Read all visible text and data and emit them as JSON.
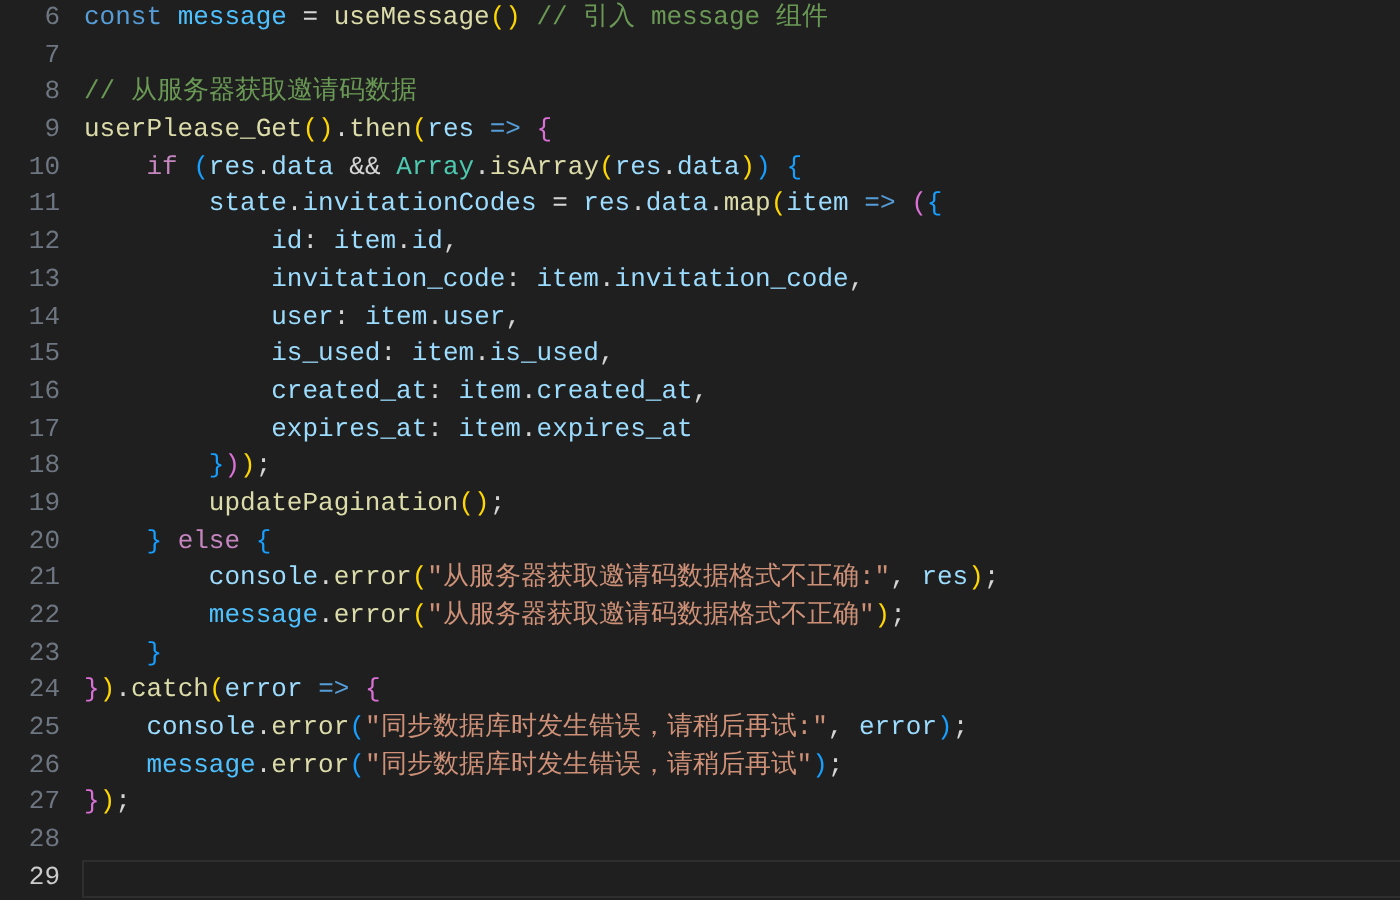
{
  "editor": {
    "lines": [
      {
        "number": "6",
        "current": false,
        "tokens": [
          {
            "kind": "storage",
            "text": "const "
          },
          {
            "kind": "const",
            "text": "message"
          },
          {
            "kind": "plain",
            "text": " = "
          },
          {
            "kind": "fn",
            "text": "useMessage"
          },
          {
            "kind": "b1",
            "text": "()"
          },
          {
            "kind": "comment",
            "text": " // 引入 message 组件"
          }
        ]
      },
      {
        "number": "7",
        "current": false
      },
      {
        "number": "8",
        "current": false,
        "tokens": [
          {
            "kind": "comment",
            "text": "// 从服务器获取邀请码数据"
          }
        ]
      },
      {
        "number": "9",
        "current": false,
        "tokens": [
          {
            "kind": "fn",
            "text": "userPlease_Get"
          },
          {
            "kind": "b1",
            "text": "()"
          },
          {
            "kind": "plain",
            "text": "."
          },
          {
            "kind": "fn",
            "text": "then"
          },
          {
            "kind": "b1",
            "text": "("
          },
          {
            "kind": "var",
            "text": "res"
          },
          {
            "kind": "storage",
            "text": " => "
          },
          {
            "kind": "b2",
            "text": "{"
          }
        ]
      },
      {
        "number": "10",
        "current": false,
        "tokens": [
          {
            "kind": "kw",
            "text": "    if "
          },
          {
            "kind": "b3",
            "text": "("
          },
          {
            "kind": "var",
            "text": "res"
          },
          {
            "kind": "plain",
            "text": "."
          },
          {
            "kind": "var",
            "text": "data"
          },
          {
            "kind": "plain",
            "text": " && "
          },
          {
            "kind": "cls",
            "text": "Array"
          },
          {
            "kind": "plain",
            "text": "."
          },
          {
            "kind": "fn",
            "text": "isArray"
          },
          {
            "kind": "b1",
            "text": "("
          },
          {
            "kind": "var",
            "text": "res"
          },
          {
            "kind": "plain",
            "text": "."
          },
          {
            "kind": "var",
            "text": "data"
          },
          {
            "kind": "b1",
            "text": ")"
          },
          {
            "kind": "b3",
            "text": ")"
          },
          {
            "kind": "b3",
            "text": " {"
          }
        ]
      },
      {
        "number": "11",
        "current": false,
        "tokens": [
          {
            "kind": "var",
            "text": "        state"
          },
          {
            "kind": "plain",
            "text": "."
          },
          {
            "kind": "var",
            "text": "invitationCodes"
          },
          {
            "kind": "plain",
            "text": " = "
          },
          {
            "kind": "var",
            "text": "res"
          },
          {
            "kind": "plain",
            "text": "."
          },
          {
            "kind": "var",
            "text": "data"
          },
          {
            "kind": "plain",
            "text": "."
          },
          {
            "kind": "fn",
            "text": "map"
          },
          {
            "kind": "b1",
            "text": "("
          },
          {
            "kind": "var",
            "text": "item"
          },
          {
            "kind": "storage",
            "text": " => "
          },
          {
            "kind": "b2",
            "text": "("
          },
          {
            "kind": "b3",
            "text": "{"
          }
        ]
      },
      {
        "number": "12",
        "current": false,
        "tokens": [
          {
            "kind": "var",
            "text": "            id"
          },
          {
            "kind": "plain",
            "text": ": "
          },
          {
            "kind": "var",
            "text": "item"
          },
          {
            "kind": "plain",
            "text": "."
          },
          {
            "kind": "var",
            "text": "id"
          },
          {
            "kind": "plain",
            "text": ","
          }
        ]
      },
      {
        "number": "13",
        "current": false,
        "tokens": [
          {
            "kind": "var",
            "text": "            invitation_code"
          },
          {
            "kind": "plain",
            "text": ": "
          },
          {
            "kind": "var",
            "text": "item"
          },
          {
            "kind": "plain",
            "text": "."
          },
          {
            "kind": "var",
            "text": "invitation_code"
          },
          {
            "kind": "plain",
            "text": ","
          }
        ]
      },
      {
        "number": "14",
        "current": false,
        "tokens": [
          {
            "kind": "var",
            "text": "            user"
          },
          {
            "kind": "plain",
            "text": ": "
          },
          {
            "kind": "var",
            "text": "item"
          },
          {
            "kind": "plain",
            "text": "."
          },
          {
            "kind": "var",
            "text": "user"
          },
          {
            "kind": "plain",
            "text": ","
          }
        ]
      },
      {
        "number": "15",
        "current": false,
        "tokens": [
          {
            "kind": "var",
            "text": "            is_used"
          },
          {
            "kind": "plain",
            "text": ": "
          },
          {
            "kind": "var",
            "text": "item"
          },
          {
            "kind": "plain",
            "text": "."
          },
          {
            "kind": "var",
            "text": "is_used"
          },
          {
            "kind": "plain",
            "text": ","
          }
        ]
      },
      {
        "number": "16",
        "current": false,
        "tokens": [
          {
            "kind": "var",
            "text": "            created_at"
          },
          {
            "kind": "plain",
            "text": ": "
          },
          {
            "kind": "var",
            "text": "item"
          },
          {
            "kind": "plain",
            "text": "."
          },
          {
            "kind": "var",
            "text": "created_at"
          },
          {
            "kind": "plain",
            "text": ","
          }
        ]
      },
      {
        "number": "17",
        "current": false,
        "tokens": [
          {
            "kind": "var",
            "text": "            expires_at"
          },
          {
            "kind": "plain",
            "text": ": "
          },
          {
            "kind": "var",
            "text": "item"
          },
          {
            "kind": "plain",
            "text": "."
          },
          {
            "kind": "var",
            "text": "expires_at"
          }
        ]
      },
      {
        "number": "18",
        "current": false,
        "tokens": [
          {
            "kind": "b3",
            "text": "        }"
          },
          {
            "kind": "b2",
            "text": ")"
          },
          {
            "kind": "b1",
            "text": ")"
          },
          {
            "kind": "plain",
            "text": ";"
          }
        ]
      },
      {
        "number": "19",
        "current": false,
        "tokens": [
          {
            "kind": "fn",
            "text": "        updatePagination"
          },
          {
            "kind": "b1",
            "text": "()"
          },
          {
            "kind": "plain",
            "text": ";"
          }
        ]
      },
      {
        "number": "20",
        "current": false,
        "tokens": [
          {
            "kind": "b3",
            "text": "    }"
          },
          {
            "kind": "kw",
            "text": " else "
          },
          {
            "kind": "b3",
            "text": "{"
          }
        ]
      },
      {
        "number": "21",
        "current": false,
        "tokens": [
          {
            "kind": "var",
            "text": "        console"
          },
          {
            "kind": "plain",
            "text": "."
          },
          {
            "kind": "fn",
            "text": "error"
          },
          {
            "kind": "b1",
            "text": "("
          },
          {
            "kind": "str",
            "text": "\"从服务器获取邀请码数据格式不正确:\""
          },
          {
            "kind": "plain",
            "text": ", "
          },
          {
            "kind": "var",
            "text": "res"
          },
          {
            "kind": "b1",
            "text": ")"
          },
          {
            "kind": "plain",
            "text": ";"
          }
        ]
      },
      {
        "number": "22",
        "current": false,
        "tokens": [
          {
            "kind": "const",
            "text": "        message"
          },
          {
            "kind": "plain",
            "text": "."
          },
          {
            "kind": "fn",
            "text": "error"
          },
          {
            "kind": "b1",
            "text": "("
          },
          {
            "kind": "str",
            "text": "\"从服务器获取邀请码数据格式不正确\""
          },
          {
            "kind": "b1",
            "text": ")"
          },
          {
            "kind": "plain",
            "text": ";"
          }
        ]
      },
      {
        "number": "23",
        "current": false,
        "tokens": [
          {
            "kind": "b3",
            "text": "    }"
          }
        ]
      },
      {
        "number": "24",
        "current": false,
        "tokens": [
          {
            "kind": "b2",
            "text": "}"
          },
          {
            "kind": "b1",
            "text": ")"
          },
          {
            "kind": "plain",
            "text": "."
          },
          {
            "kind": "fn",
            "text": "catch"
          },
          {
            "kind": "b1",
            "text": "("
          },
          {
            "kind": "var",
            "text": "error"
          },
          {
            "kind": "storage",
            "text": " => "
          },
          {
            "kind": "b2",
            "text": "{"
          }
        ]
      },
      {
        "number": "25",
        "current": false,
        "tokens": [
          {
            "kind": "var",
            "text": "    console"
          },
          {
            "kind": "plain",
            "text": "."
          },
          {
            "kind": "fn",
            "text": "error"
          },
          {
            "kind": "b3",
            "text": "("
          },
          {
            "kind": "str",
            "text": "\"同步数据库时发生错误，请稍后再试:\""
          },
          {
            "kind": "plain",
            "text": ", "
          },
          {
            "kind": "var",
            "text": "error"
          },
          {
            "kind": "b3",
            "text": ")"
          },
          {
            "kind": "plain",
            "text": ";"
          }
        ]
      },
      {
        "number": "26",
        "current": false,
        "tokens": [
          {
            "kind": "const",
            "text": "    message"
          },
          {
            "kind": "plain",
            "text": "."
          },
          {
            "kind": "fn",
            "text": "error"
          },
          {
            "kind": "b3",
            "text": "("
          },
          {
            "kind": "str",
            "text": "\"同步数据库时发生错误，请稍后再试\""
          },
          {
            "kind": "b3",
            "text": ")"
          },
          {
            "kind": "plain",
            "text": ";"
          }
        ]
      },
      {
        "number": "27",
        "current": false,
        "tokens": [
          {
            "kind": "b2",
            "text": "}"
          },
          {
            "kind": "b1",
            "text": ")"
          },
          {
            "kind": "plain",
            "text": ";"
          }
        ]
      },
      {
        "number": "28",
        "current": false
      },
      {
        "number": "29",
        "current": true
      }
    ]
  }
}
